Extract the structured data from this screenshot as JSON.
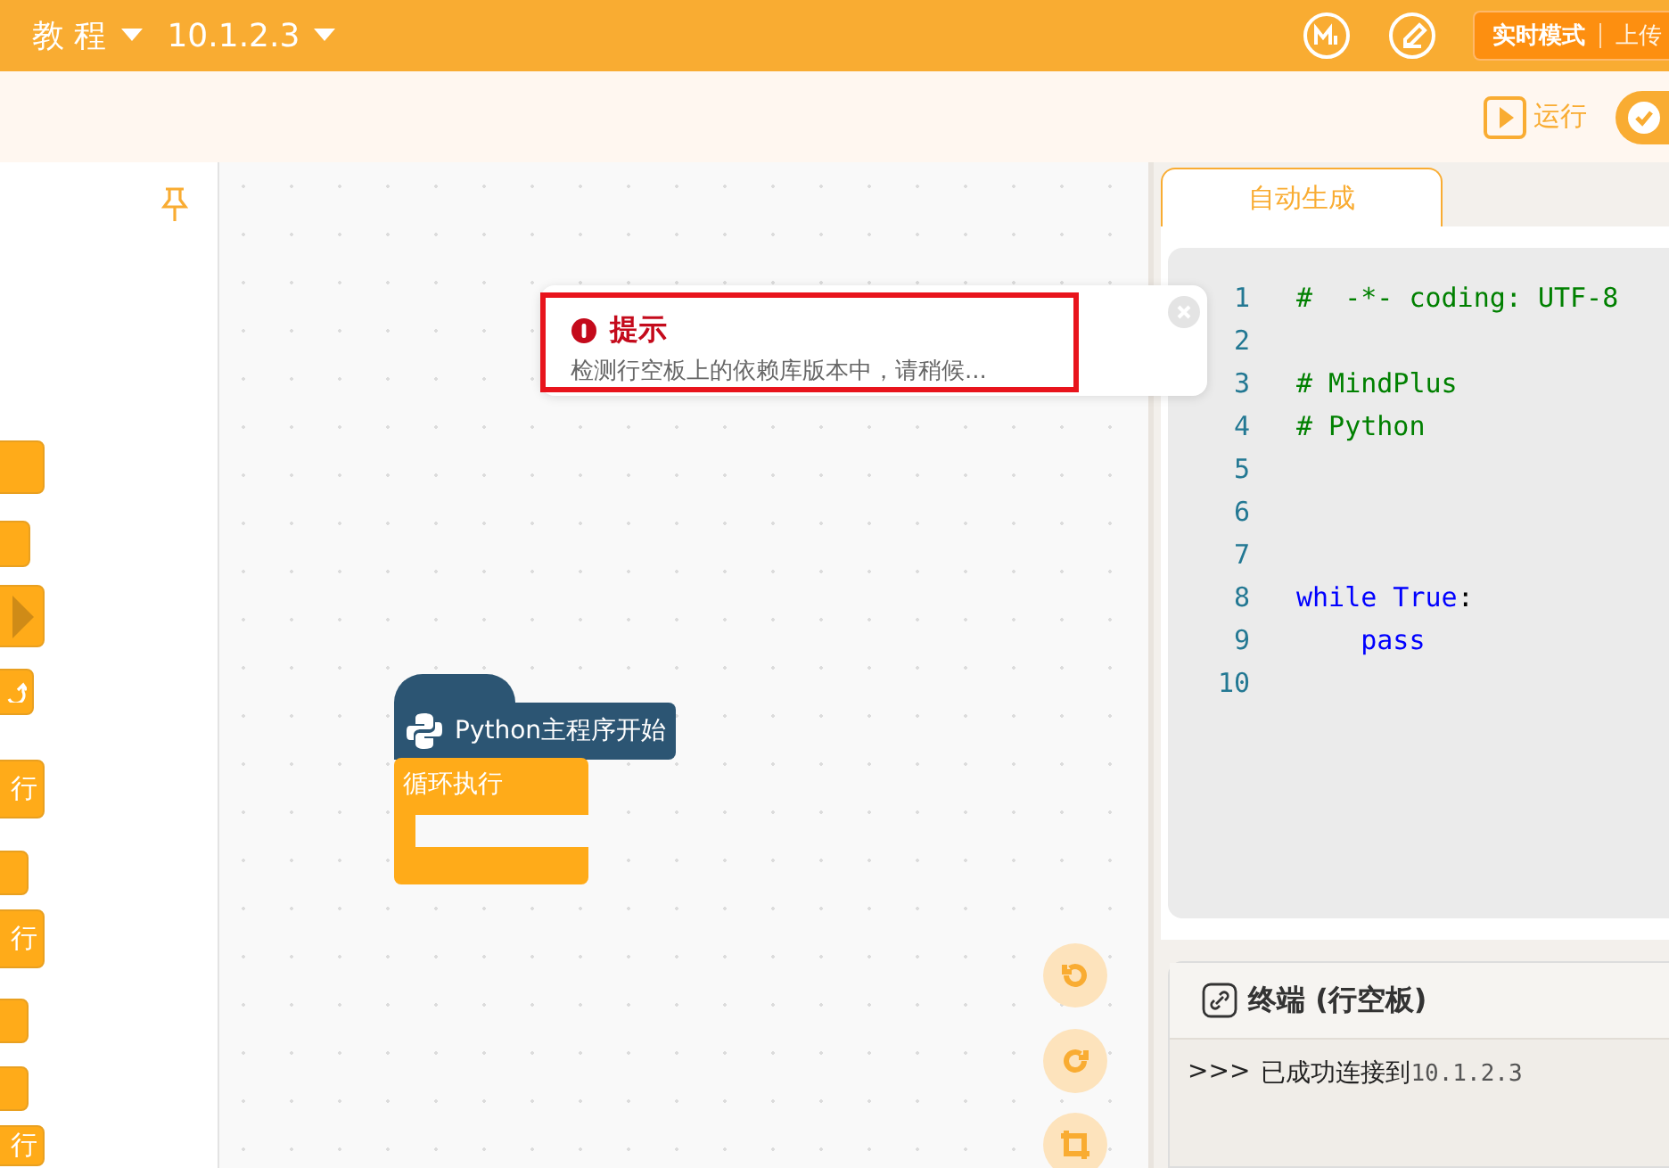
{
  "topbar": {
    "menus": [
      "教 程",
      "10.1.2.3"
    ],
    "modes": [
      {
        "label": "实时模式",
        "selected": true
      },
      {
        "label": "上传",
        "selected": false
      }
    ]
  },
  "toolbar": {
    "run": "运行"
  },
  "palette": {
    "blocks": [
      {
        "kind": "plain"
      },
      {
        "kind": "plain"
      },
      {
        "kind": "diamond"
      },
      {
        "kind": "arrow"
      },
      {
        "kind": "plain",
        "label": "行"
      },
      {
        "kind": "plain"
      },
      {
        "kind": "plain",
        "label": "行"
      },
      {
        "kind": "plain"
      },
      {
        "kind": "plain"
      },
      {
        "kind": "plain",
        "label": "行"
      }
    ]
  },
  "canvas": {
    "hat_block": "Python主程序开始",
    "loop_block": "循环执行"
  },
  "toast": {
    "title": "提示",
    "message": "检测行空板上的依赖库版本中，请稍候..."
  },
  "code_panel": {
    "tabs": [
      {
        "label": "自动生成",
        "selected": true
      }
    ],
    "lines": [
      {
        "number": "1",
        "segments": [
          {
            "kind": "comment",
            "text": "#  -*- coding: UTF-8"
          }
        ]
      },
      {
        "number": "2"
      },
      {
        "number": "3",
        "segments": [
          {
            "kind": "comment",
            "text": "# MindPlus"
          }
        ]
      },
      {
        "number": "4",
        "segments": [
          {
            "kind": "comment",
            "text": "# Python"
          }
        ]
      },
      {
        "number": "5"
      },
      {
        "number": "6"
      },
      {
        "number": "7"
      },
      {
        "number": "8",
        "segments": [
          {
            "kind": "keyword",
            "text": "while True"
          },
          {
            "kind": "plain",
            "text": ":"
          }
        ]
      },
      {
        "number": "9",
        "segments": [
          {
            "kind": "keyword",
            "text": "    pass"
          }
        ]
      },
      {
        "number": "10"
      }
    ]
  },
  "terminal": {
    "title": "终端 (行空板)",
    "prompt": ">>>",
    "message": "已成功连接到",
    "address": "10.1.2.3"
  }
}
